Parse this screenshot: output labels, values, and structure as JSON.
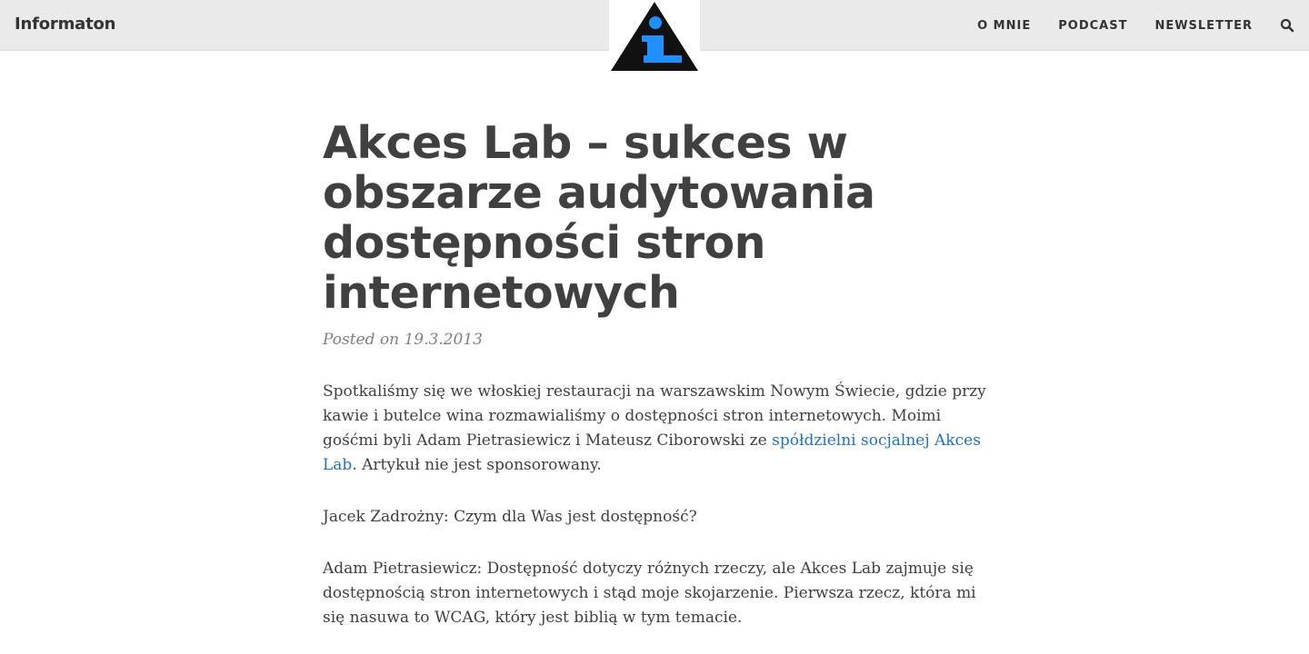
{
  "header": {
    "brand": "Informaton",
    "logo_icon": "info-triangle-icon",
    "nav": [
      "O MNIE",
      "PODCAST",
      "NEWSLETTER"
    ],
    "search_icon": "search-icon"
  },
  "article": {
    "title": "Akces Lab – sukces w obszarze audytowania dostępności stron internetowych",
    "meta": "Posted on 19.3.2013",
    "p1_before": "Spotkaliśmy się we włoskiej restauracji na warszawskim Nowym Świecie, gdzie przy kawie i butelce wina rozmawialiśmy o dostępności stron internetowych. Moimi gośćmi byli Adam Pietrasiewicz i Mateusz Ciborowski ze ",
    "p1_link": "spółdzielni socjalnej Akces Lab",
    "p1_after": ". Artykuł nie jest sponsorowany.",
    "p2": "Jacek Zadrożny: Czym dla Was jest dostępność?",
    "p3": "Adam Pietrasiewicz: Dostępność dotyczy różnych rzeczy, ale Akces Lab zajmuje się dostępnością stron internetowych i stąd moje skojarzenie. Pierwsza rzecz, która mi się nasuwa to WCAG, który jest biblią w tym temacie."
  },
  "colors": {
    "header_bg": "#eaeaea",
    "text": "#404040",
    "link": "#1e73be",
    "logo_accent": "#1e90ff"
  }
}
